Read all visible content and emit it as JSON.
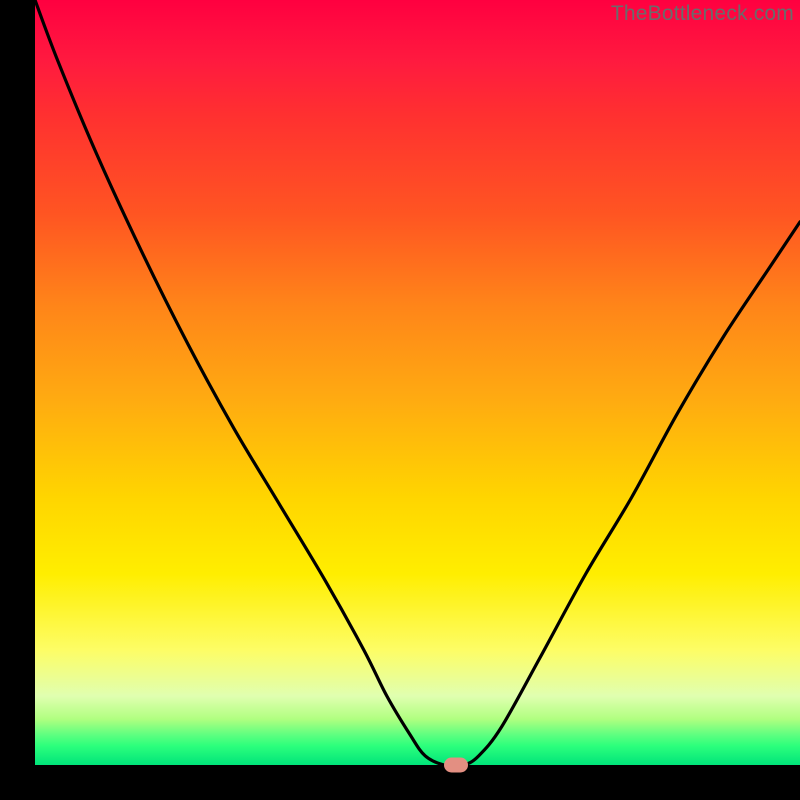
{
  "watermark": "TheBottleneck.com",
  "chart_data": {
    "type": "line",
    "title": "",
    "xlabel": "",
    "ylabel": "",
    "xlim": [
      0,
      100
    ],
    "ylim": [
      0,
      100
    ],
    "grid": false,
    "legend": false,
    "x": [
      0,
      3,
      8,
      14,
      20,
      26,
      32,
      38,
      43,
      46,
      49,
      51,
      53.5,
      56,
      58,
      61,
      66,
      72,
      78,
      84,
      90,
      96,
      100
    ],
    "values": [
      100,
      92,
      80,
      67,
      55,
      44,
      34,
      24,
      15,
      9,
      4,
      1.2,
      0,
      0,
      1.2,
      5,
      14,
      25,
      35,
      46,
      56,
      65,
      71
    ],
    "marker": {
      "x": 55,
      "y": 0,
      "color": "#e38f82"
    },
    "background_gradient": [
      "#ff0040",
      "#ff5522",
      "#ffaa11",
      "#ffee00",
      "#b0ff80",
      "#00e47a"
    ]
  }
}
